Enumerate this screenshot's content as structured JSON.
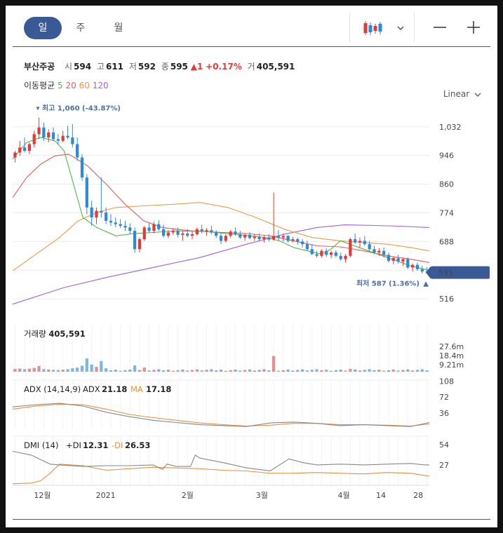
{
  "tabs": [
    {
      "label": "일",
      "active": true
    },
    {
      "label": "주",
      "active": false
    },
    {
      "label": "월",
      "active": false
    }
  ],
  "toolbar": {
    "chart_type_icon": "candlestick-icon",
    "dropdown_icon": "chevron-down-icon",
    "zoom_out_icon": "minus-icon",
    "zoom_in_icon": "plus-icon"
  },
  "stock": {
    "name": "부산주공",
    "open_label": "시",
    "open": "594",
    "high_label": "고",
    "high": "611",
    "low_label": "저",
    "low": "592",
    "close_label": "종",
    "close": "595",
    "change": "▲1",
    "change_pct": "+0.17%",
    "volume_label": "거",
    "volume": "405,591"
  },
  "ma_legend": {
    "label": "이동평균",
    "periods": [
      {
        "text": "5",
        "color": "#53b34a"
      },
      {
        "text": "20",
        "color": "#e65a5a"
      },
      {
        "text": "60",
        "color": "#f09a47"
      },
      {
        "text": "120",
        "color": "#a45fe0"
      }
    ]
  },
  "scale_selector": {
    "label": "Linear",
    "icon": "chevron-down-icon"
  },
  "colors": {
    "up": "#e23b36",
    "down": "#2e8ad6",
    "accent": "#3a5a96"
  },
  "chart_data": {
    "type": "candlestick",
    "price_panel": {
      "y_ticks": [
        516,
        602,
        688,
        774,
        860,
        946,
        1032
      ],
      "y_tick_labels": [
        "516",
        "",
        "688",
        "774",
        "860",
        "946",
        "1,032"
      ],
      "ylim": [
        470,
        1080
      ],
      "last_price_label": "595",
      "max_annotation": "최고 1,060 (-43.87%)",
      "min_annotation": "최저 587 (1.36%)",
      "ma5": [
        [
          0,
          935
        ],
        [
          6,
          985
        ],
        [
          12,
          1000
        ],
        [
          18,
          990
        ],
        [
          22,
          960
        ],
        [
          26,
          860
        ],
        [
          30,
          760
        ],
        [
          36,
          730
        ],
        [
          44,
          705
        ],
        [
          52,
          712
        ],
        [
          60,
          715
        ],
        [
          70,
          720
        ],
        [
          82,
          718
        ],
        [
          92,
          712
        ],
        [
          100,
          706
        ],
        [
          108,
          700
        ],
        [
          114,
          690
        ],
        [
          120,
          670
        ],
        [
          126,
          660
        ],
        [
          132,
          650
        ],
        [
          136,
          665
        ],
        [
          140,
          690
        ],
        [
          146,
          675
        ],
        [
          152,
          660
        ],
        [
          158,
          645
        ],
        [
          164,
          630
        ],
        [
          170,
          615
        ],
        [
          176,
          605
        ],
        [
          178,
          600
        ]
      ],
      "ma20": [
        [
          0,
          820
        ],
        [
          6,
          880
        ],
        [
          12,
          920
        ],
        [
          18,
          945
        ],
        [
          24,
          950
        ],
        [
          32,
          915
        ],
        [
          40,
          860
        ],
        [
          48,
          800
        ],
        [
          56,
          750
        ],
        [
          64,
          730
        ],
        [
          76,
          720
        ],
        [
          90,
          715
        ],
        [
          100,
          712
        ],
        [
          110,
          705
        ],
        [
          120,
          690
        ],
        [
          130,
          675
        ],
        [
          140,
          672
        ],
        [
          150,
          660
        ],
        [
          160,
          645
        ],
        [
          170,
          635
        ],
        [
          178,
          625
        ]
      ],
      "ma60": [
        [
          0,
          600
        ],
        [
          10,
          650
        ],
        [
          20,
          700
        ],
        [
          28,
          750
        ],
        [
          36,
          775
        ],
        [
          44,
          790
        ],
        [
          56,
          795
        ],
        [
          70,
          800
        ],
        [
          80,
          805
        ],
        [
          92,
          790
        ],
        [
          104,
          760
        ],
        [
          116,
          725
        ],
        [
          128,
          700
        ],
        [
          140,
          690
        ],
        [
          150,
          685
        ],
        [
          160,
          680
        ],
        [
          170,
          670
        ],
        [
          178,
          660
        ]
      ],
      "ma120": [
        [
          0,
          500
        ],
        [
          22,
          550
        ],
        [
          40,
          580
        ],
        [
          60,
          610
        ],
        [
          80,
          640
        ],
        [
          100,
          680
        ],
        [
          116,
          710
        ],
        [
          130,
          730
        ],
        [
          142,
          738
        ],
        [
          155,
          736
        ],
        [
          165,
          734
        ],
        [
          178,
          730
        ]
      ],
      "candles": [
        [
          940,
          960,
          925,
          955
        ],
        [
          955,
          990,
          945,
          970
        ],
        [
          970,
          1000,
          955,
          960
        ],
        [
          960,
          985,
          950,
          980
        ],
        [
          980,
          1020,
          970,
          1010
        ],
        [
          1010,
          1060,
          995,
          1030
        ],
        [
          1030,
          1045,
          990,
          1000
        ],
        [
          1000,
          1025,
          985,
          1015
        ],
        [
          1015,
          1030,
          990,
          995
        ],
        [
          995,
          1010,
          980,
          990
        ],
        [
          990,
          1020,
          985,
          1005
        ],
        [
          1005,
          1035,
          995,
          1000
        ],
        [
          1000,
          1040,
          970,
          980
        ],
        [
          980,
          1000,
          930,
          940
        ],
        [
          940,
          950,
          870,
          880
        ],
        [
          880,
          890,
          770,
          790
        ],
        [
          790,
          810,
          735,
          760
        ],
        [
          760,
          790,
          740,
          780
        ],
        [
          780,
          880,
          760,
          775
        ],
        [
          775,
          790,
          740,
          750
        ],
        [
          750,
          770,
          735,
          745
        ],
        [
          745,
          760,
          730,
          740
        ],
        [
          740,
          755,
          728,
          735
        ],
        [
          735,
          750,
          720,
          730
        ],
        [
          730,
          742,
          710,
          720
        ],
        [
          720,
          730,
          655,
          665
        ],
        [
          665,
          700,
          655,
          695
        ],
        [
          695,
          735,
          690,
          730
        ],
        [
          730,
          745,
          715,
          720
        ],
        [
          720,
          748,
          712,
          740
        ],
        [
          740,
          752,
          720,
          725
        ],
        [
          725,
          738,
          700,
          705
        ],
        [
          705,
          722,
          698,
          715
        ],
        [
          715,
          728,
          708,
          720
        ],
        [
          720,
          730,
          700,
          708
        ],
        [
          708,
          720,
          690,
          712
        ],
        [
          712,
          725,
          700,
          705
        ],
        [
          705,
          718,
          695,
          710
        ],
        [
          710,
          730,
          705,
          725
        ],
        [
          725,
          738,
          712,
          718
        ],
        [
          718,
          728,
          705,
          722
        ],
        [
          722,
          735,
          710,
          715
        ],
        [
          715,
          722,
          698,
          705
        ],
        [
          705,
          715,
          680,
          690
        ],
        [
          690,
          710,
          685,
          705
        ],
        [
          705,
          722,
          700,
          718
        ],
        [
          718,
          730,
          705,
          710
        ],
        [
          710,
          720,
          695,
          700
        ],
        [
          700,
          712,
          690,
          708
        ],
        [
          708,
          716,
          695,
          698
        ],
        [
          698,
          710,
          690,
          702
        ],
        [
          702,
          712,
          690,
          695
        ],
        [
          695,
          705,
          685,
          700
        ],
        [
          700,
          710,
          688,
          694
        ],
        [
          694,
          835,
          690,
          705
        ],
        [
          705,
          722,
          690,
          700
        ],
        [
          700,
          712,
          688,
          705
        ],
        [
          705,
          708,
          685,
          690
        ],
        [
          690,
          702,
          685,
          695
        ],
        [
          695,
          700,
          678,
          688
        ],
        [
          688,
          695,
          670,
          680
        ],
        [
          680,
          690,
          660,
          665
        ],
        [
          665,
          680,
          648,
          650
        ],
        [
          650,
          660,
          640,
          645
        ],
        [
          645,
          665,
          640,
          660
        ],
        [
          660,
          668,
          642,
          648
        ],
        [
          648,
          660,
          638,
          655
        ],
        [
          655,
          662,
          640,
          645
        ],
        [
          645,
          655,
          630,
          635
        ],
        [
          635,
          650,
          625,
          645
        ],
        [
          645,
          700,
          640,
          695
        ],
        [
          695,
          712,
          680,
          685
        ],
        [
          685,
          700,
          670,
          690
        ],
        [
          690,
          705,
          675,
          680
        ],
        [
          680,
          690,
          660,
          665
        ],
        [
          665,
          675,
          650,
          655
        ],
        [
          655,
          668,
          645,
          660
        ],
        [
          660,
          670,
          640,
          648
        ],
        [
          648,
          655,
          625,
          630
        ],
        [
          630,
          642,
          620,
          638
        ],
        [
          638,
          648,
          622,
          628
        ],
        [
          628,
          640,
          615,
          635
        ],
        [
          635,
          640,
          605,
          610
        ],
        [
          610,
          622,
          598,
          618
        ],
        [
          618,
          625,
          600,
          605
        ],
        [
          605,
          615,
          592,
          598
        ],
        [
          598,
          611,
          592,
          595
        ]
      ]
    },
    "volume_panel": {
      "title": "거래량",
      "last_value": "405,591",
      "y_tick_labels": [
        "27.6m",
        "18.4m",
        "9.21m"
      ],
      "ylim": [
        0,
        30000000
      ]
    },
    "adx_panel": {
      "title": "ADX (14,14,9)",
      "adx_label": "ADX",
      "adx_value": "21.18",
      "ma_label": "MA",
      "ma_value": "17.18",
      "y_tick_labels": [
        "108",
        "72",
        "36"
      ],
      "ylim": [
        0,
        110
      ],
      "adx": [
        [
          0,
          50
        ],
        [
          10,
          55
        ],
        [
          20,
          58
        ],
        [
          30,
          52
        ],
        [
          40,
          38
        ],
        [
          50,
          28
        ],
        [
          60,
          20
        ],
        [
          70,
          15
        ],
        [
          80,
          10
        ],
        [
          90,
          8
        ],
        [
          100,
          6
        ],
        [
          110,
          14
        ],
        [
          120,
          16
        ],
        [
          130,
          13
        ],
        [
          140,
          8
        ],
        [
          150,
          10
        ],
        [
          160,
          8
        ],
        [
          170,
          6
        ],
        [
          178,
          15
        ]
      ],
      "ma": [
        [
          0,
          45
        ],
        [
          10,
          52
        ],
        [
          20,
          56
        ],
        [
          30,
          55
        ],
        [
          40,
          45
        ],
        [
          50,
          33
        ],
        [
          60,
          26
        ],
        [
          70,
          20
        ],
        [
          80,
          14
        ],
        [
          90,
          10
        ],
        [
          100,
          7
        ],
        [
          110,
          9
        ],
        [
          120,
          13
        ],
        [
          130,
          13
        ],
        [
          140,
          10
        ],
        [
          150,
          10
        ],
        [
          160,
          9
        ],
        [
          170,
          7
        ],
        [
          178,
          12
        ]
      ]
    },
    "dmi_panel": {
      "title": "DMI (14)",
      "pdi_label": "+DI",
      "pdi_value": "12.31",
      "mdi_label": "-DI",
      "mdi_value": "26.53",
      "y_tick_labels": [
        "54",
        "27"
      ],
      "ylim": [
        0,
        65
      ],
      "pdi": [
        [
          0,
          2
        ],
        [
          8,
          3
        ],
        [
          12,
          6
        ],
        [
          16,
          16
        ],
        [
          20,
          28
        ],
        [
          30,
          26
        ],
        [
          40,
          20
        ],
        [
          50,
          22
        ],
        [
          60,
          24
        ],
        [
          70,
          23
        ],
        [
          80,
          22
        ],
        [
          90,
          20
        ],
        [
          100,
          19
        ],
        [
          110,
          16
        ],
        [
          120,
          16
        ],
        [
          130,
          17
        ],
        [
          140,
          16
        ],
        [
          150,
          15
        ],
        [
          160,
          17
        ],
        [
          170,
          16
        ],
        [
          178,
          12
        ]
      ],
      "mdi": [
        [
          0,
          45
        ],
        [
          8,
          40
        ],
        [
          12,
          34
        ],
        [
          16,
          28
        ],
        [
          20,
          27
        ],
        [
          30,
          25
        ],
        [
          40,
          26
        ],
        [
          50,
          26
        ],
        [
          60,
          27
        ],
        [
          64,
          21
        ],
        [
          66,
          28
        ],
        [
          70,
          25
        ],
        [
          76,
          25
        ],
        [
          78,
          40
        ],
        [
          80,
          36
        ],
        [
          90,
          30
        ],
        [
          100,
          23
        ],
        [
          110,
          19
        ],
        [
          118,
          35
        ],
        [
          124,
          30
        ],
        [
          130,
          27
        ],
        [
          140,
          28
        ],
        [
          150,
          27
        ],
        [
          160,
          28
        ],
        [
          170,
          29
        ],
        [
          176,
          27
        ],
        [
          178,
          27
        ]
      ]
    },
    "x_axis": {
      "labels": [
        {
          "text": "12월",
          "i": 8
        },
        {
          "text": "2021",
          "i": 25
        },
        {
          "text": "2월",
          "i": 47
        },
        {
          "text": "3월",
          "i": 67
        },
        {
          "text": "4월",
          "i": 89
        },
        {
          "text": "14",
          "i": 99
        },
        {
          "text": "28",
          "i": 109
        }
      ]
    }
  }
}
